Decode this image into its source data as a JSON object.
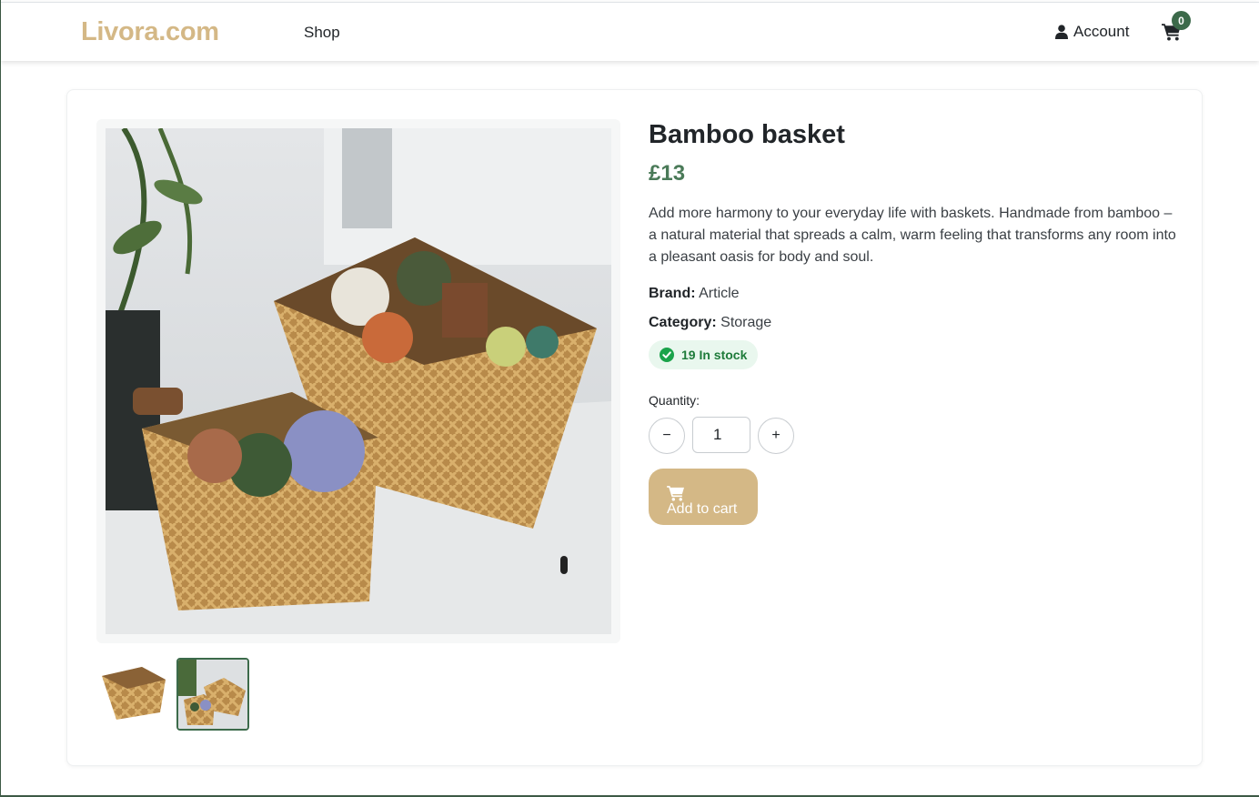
{
  "header": {
    "brand": "Livora.com",
    "nav": {
      "shop": "Shop",
      "account": "Account"
    },
    "cart_count": "0",
    "icons": {
      "account": "user-icon",
      "cart": "shopping-cart-icon"
    },
    "colors": {
      "brand": "#d4b886",
      "badge": "#3c6a4a"
    }
  },
  "product": {
    "title": "Bamboo basket",
    "price": "£13",
    "description": "Add more harmony to your everyday life with baskets. Handmade from bamboo – a natural material that spreads a calm, warm feeling that transforms any room into a pleasant oasis for body and soul.",
    "brand_label": "Brand:",
    "brand_value": "Article",
    "category_label": "Category:",
    "category_value": "Storage",
    "stock_text": "19 In stock",
    "images": {
      "main": "bamboo baskets with yarn balls on shelf",
      "thumbnails": [
        "single bamboo basket",
        "two bamboo baskets with yarn"
      ],
      "selected_thumbnail": 1
    },
    "colors": {
      "price": "#4a7a58",
      "stock": "#1e7b3a",
      "button": "#d4b886"
    }
  },
  "purchase": {
    "quantity_label": "Quantity:",
    "quantity_value": "1",
    "minus_label": "−",
    "plus_label": "+",
    "add_to_cart_label": "Add to cart"
  }
}
